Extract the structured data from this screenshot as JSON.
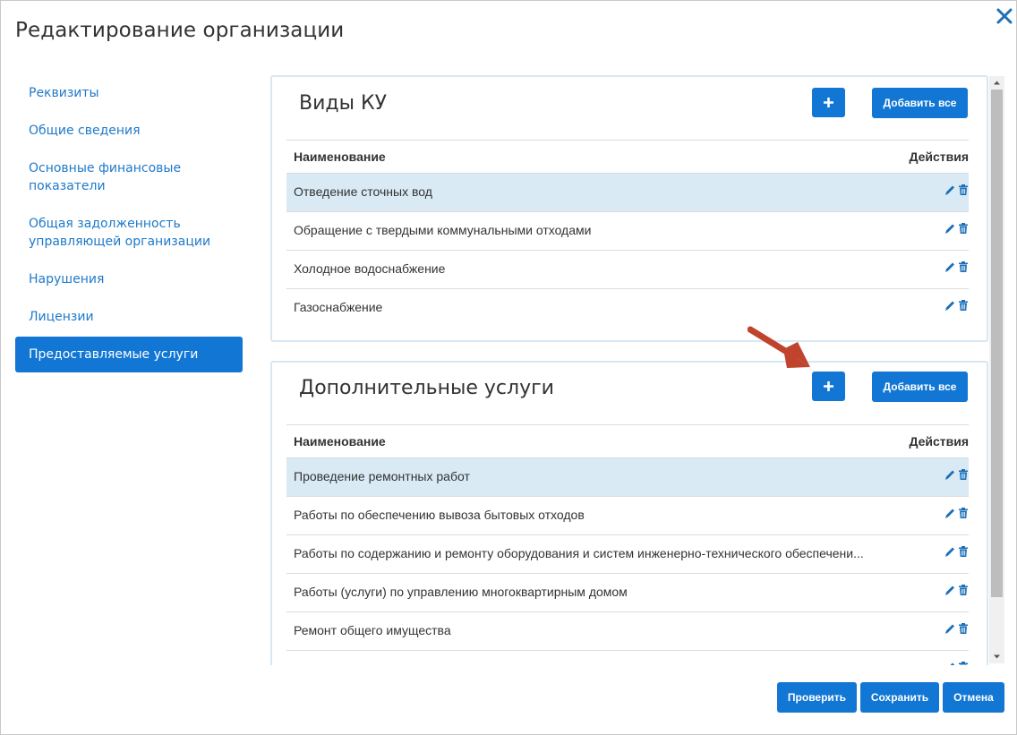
{
  "window": {
    "title": "Редактирование организации",
    "close_icon": "close-icon"
  },
  "sidebar": {
    "items": [
      {
        "label": "Реквизиты",
        "active": false
      },
      {
        "label": "Общие сведения",
        "active": false
      },
      {
        "label": "Основные финансовые показатели",
        "active": false
      },
      {
        "label": "Общая задолженность управляющей организации",
        "active": false
      },
      {
        "label": "Нарушения",
        "active": false
      },
      {
        "label": "Лицензии",
        "active": false
      },
      {
        "label": "Предоставляемые услуги",
        "active": true
      }
    ]
  },
  "sections": [
    {
      "title": "Виды КУ",
      "add_all_label": "Добавить все",
      "col_name": "Наименование",
      "col_actions": "Действия",
      "rows": [
        "Отведение сточных вод",
        "Обращение с твердыми коммунальными отходами",
        "Холодное водоснабжение",
        "Газоснабжение"
      ]
    },
    {
      "title": "Дополнительные услуги",
      "add_all_label": "Добавить все",
      "col_name": "Наименование",
      "col_actions": "Действия",
      "rows": [
        "Проведение ремонтных работ",
        "Работы по обеспечению вывоза бытовых отходов",
        "Работы по содержанию и ремонту оборудования и систем инженерно-технического обеспечени...",
        "Работы (услуги) по управлению многоквартирным домом",
        "Ремонт общего имущества",
        ""
      ]
    }
  ],
  "footer": {
    "check_label": "Проверить",
    "save_label": "Сохранить",
    "cancel_label": "Отмена"
  },
  "colors": {
    "accent": "#1277d4",
    "link": "#1f7ac9",
    "row_highlight": "#d9eaf4",
    "annotation_arrow": "#c0432d"
  }
}
